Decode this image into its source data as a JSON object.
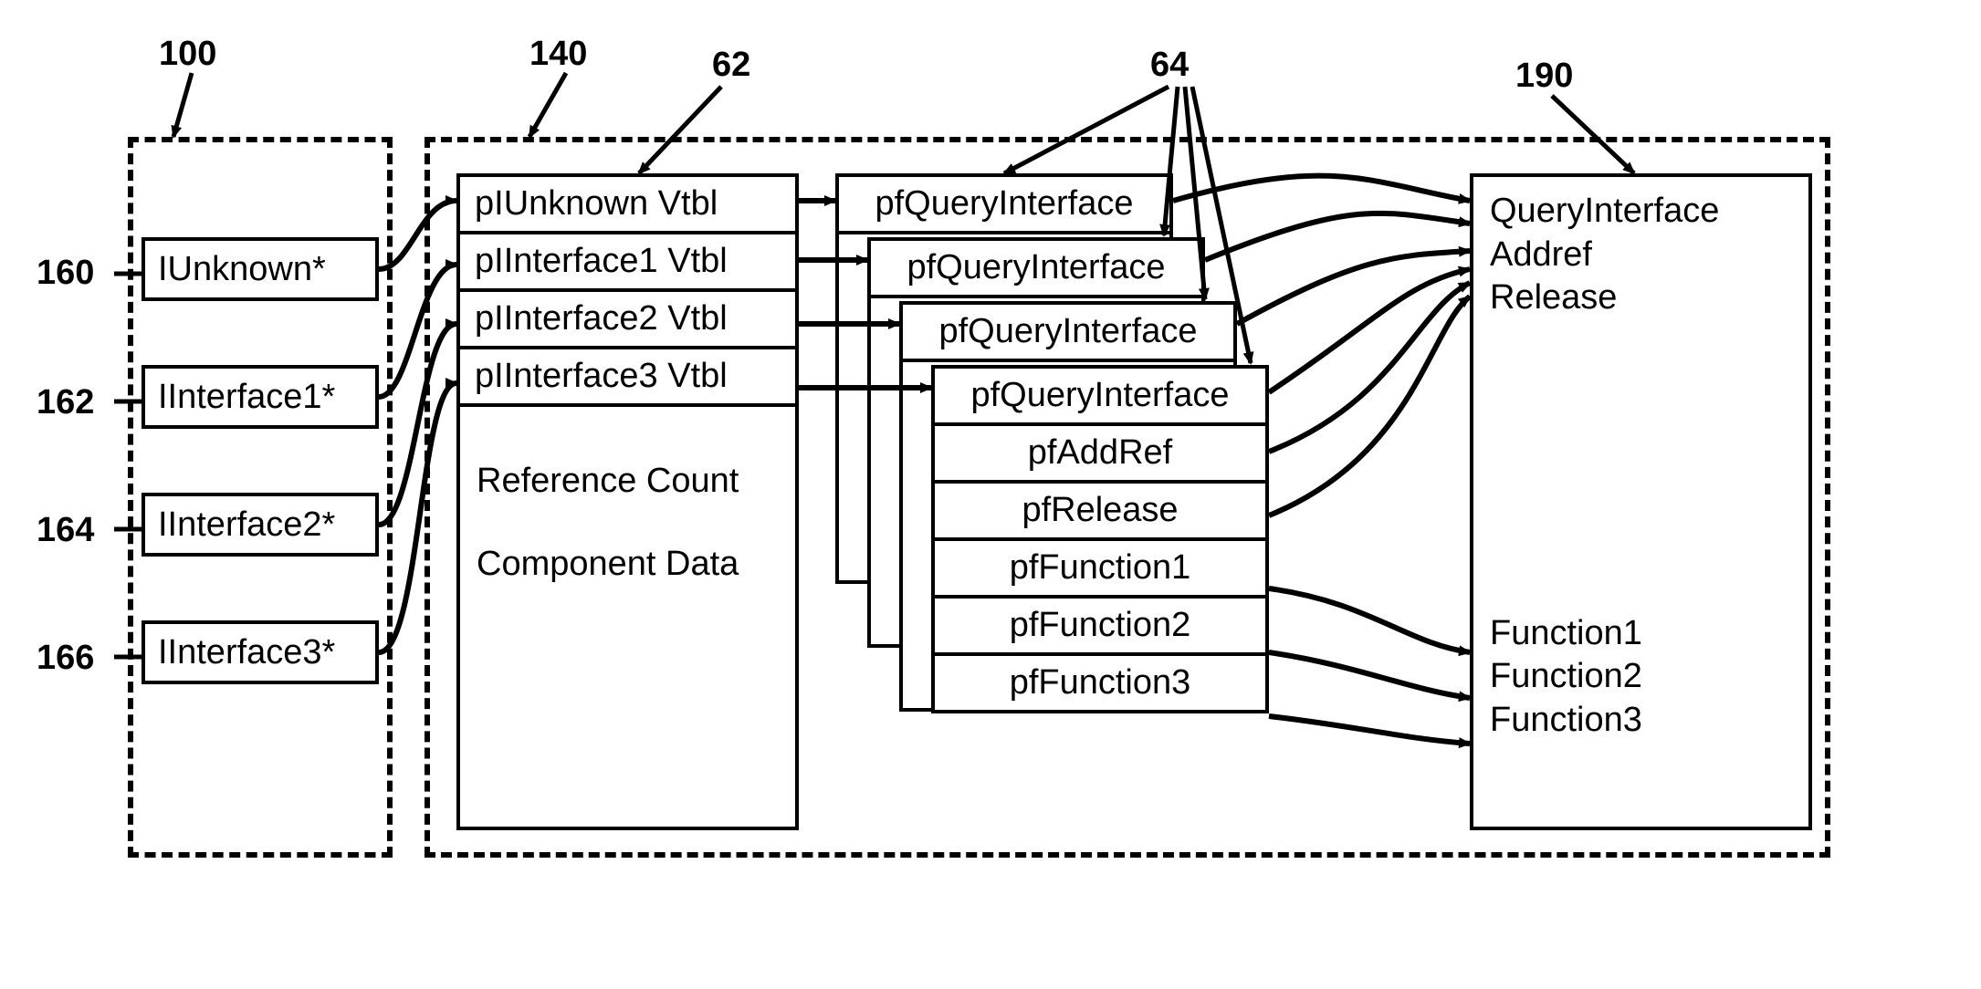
{
  "labels": {
    "n100": "100",
    "n140": "140",
    "n62": "62",
    "n64": "64",
    "n190": "190",
    "n160": "160",
    "n162": "162",
    "n164": "164",
    "n166": "166"
  },
  "pointers": {
    "p0": "IUnknown*",
    "p1": "IInterface1*",
    "p2": "IInterface2*",
    "p3": "IInterface3*"
  },
  "component": {
    "row0": "pIUnknown Vtbl",
    "row1": "pIInterface1 Vtbl",
    "row2": "pIInterface2 Vtbl",
    "row3": "pIInterface3 Vtbl",
    "refcount": "Reference Count",
    "compdata": "Component Data"
  },
  "vtbl": {
    "pfqi": "pfQueryInterface",
    "pfaddref": "pfAddRef",
    "pfrelease": "pfRelease",
    "pff1": "pfFunction1",
    "pff2": "pfFunction2",
    "pff3": "pfFunction3"
  },
  "functions": {
    "qi": "QueryInterface",
    "addref": "Addref",
    "release": "Release",
    "f1": "Function1",
    "f2": "Function2",
    "f3": "Function3"
  }
}
